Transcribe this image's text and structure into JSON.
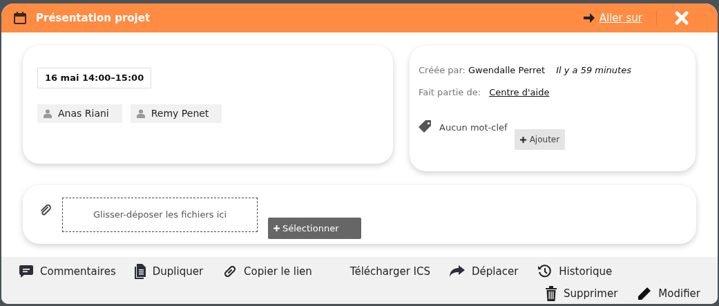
{
  "window": {
    "title": "Présentation projet",
    "goto_link": "Aller sur"
  },
  "event": {
    "date": "16 mai 14:00–15:00",
    "participants": [
      "Anas Riani",
      "Remy Penet"
    ]
  },
  "info": {
    "created_by_label": "Créée par:",
    "created_by": "Gwendalle Perret",
    "created_ago": "Il y a 59 minutes",
    "part_of_label": "Fait partie de:",
    "part_of": "Centre d'aide",
    "tags_empty": "Aucun mot-clef",
    "add_tag_button": "Ajouter"
  },
  "attachments": {
    "dropzone": "Glisser-déposer les fichiers ici",
    "select_button": "Sélectionner"
  },
  "actions": [
    {
      "label": "Commentaires",
      "kind": "comment"
    },
    {
      "label": "Dupliquer",
      "kind": "document"
    },
    {
      "label": "Copier le lien",
      "kind": "link"
    },
    {
      "label": "Télécharger ICS",
      "kind": "text"
    },
    {
      "label": "Déplacer",
      "kind": "share"
    },
    {
      "label": "Historique",
      "kind": "history"
    },
    {
      "label": "Supprimer",
      "kind": "trash"
    },
    {
      "label": "Modifier",
      "kind": "pencil"
    }
  ]
}
